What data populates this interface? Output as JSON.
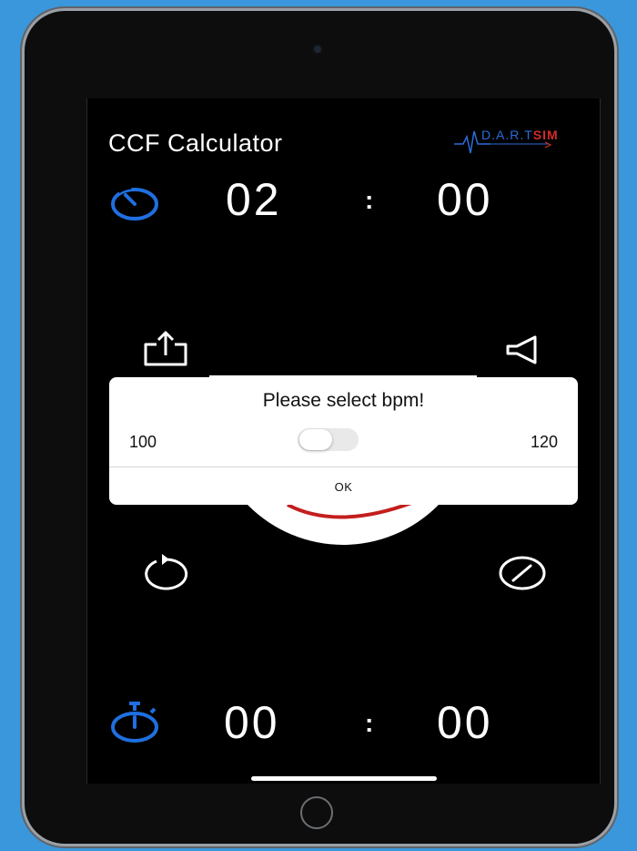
{
  "app": {
    "title": "CCF Calculator",
    "logo": {
      "prefix": "D.A.R.T",
      "suffix": "SIM"
    }
  },
  "timers": {
    "top": {
      "left": "02",
      "separator": ":",
      "right": "00",
      "icon": "timer-icon"
    },
    "bottom": {
      "left": "00",
      "separator": ":",
      "right": "00",
      "icon": "stopwatch-icon"
    }
  },
  "controls": {
    "share": "share-icon",
    "sound": "speaker-icon",
    "reset": "reset-icon",
    "edit": "pencil-icon"
  },
  "dialog": {
    "title": "Please select bpm!",
    "option_left": "100",
    "option_right": "120",
    "toggle_on": false,
    "ok_label": "OK"
  },
  "colors": {
    "background": "#3a97dc",
    "accent_blue": "#1f6fe0",
    "dial_red": "#c41e1e",
    "logo_red": "#d42a2a"
  }
}
